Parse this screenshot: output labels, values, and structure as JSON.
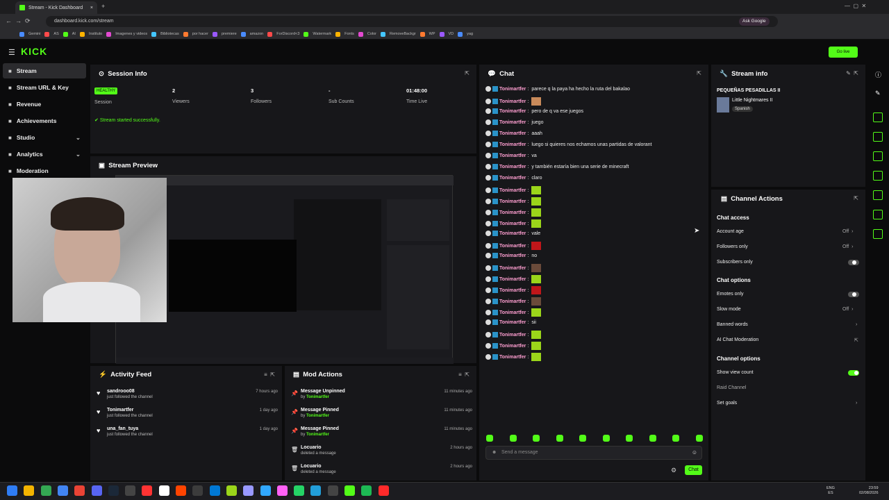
{
  "browser": {
    "tab_title": "Stream - Kick Dashboard",
    "url": "dashboard.kick.com/stream",
    "ask_google": "Ask Google",
    "bookmarks": [
      "Gemini",
      "AS",
      "AI",
      "Instituto",
      "Imagenes y videos",
      "Bibliotecas",
      "por hacer",
      "premiere",
      "amazon",
      "ForDiscord<3",
      "Watermark",
      "Fonts",
      "Color",
      "RemoveBackgr",
      "WP",
      "VD",
      "yag"
    ]
  },
  "brand": {
    "logo": "KICK",
    "accent": "#53fc18"
  },
  "header": {
    "go_live": "Go live"
  },
  "sidebar": {
    "items": [
      {
        "label": "Stream",
        "icon": "stream-icon"
      },
      {
        "label": "Stream URL & Key",
        "icon": "key-icon"
      },
      {
        "label": "Revenue",
        "icon": "money-icon"
      },
      {
        "label": "Achievements",
        "icon": "trophy-icon"
      },
      {
        "label": "Studio",
        "icon": "studio-icon"
      },
      {
        "label": "Analytics",
        "icon": "chart-icon"
      },
      {
        "label": "Moderation",
        "icon": "wrench-icon"
      }
    ]
  },
  "session": {
    "title": "Session Info",
    "health": "HEALTHY",
    "health_label": "Session",
    "viewers": "2",
    "viewers_label": "Viewers",
    "followers": "3",
    "followers_label": "Followers",
    "subs": "-",
    "subs_label": "Sub Counts",
    "time": "01:48:00",
    "time_label": "Time Live",
    "notice": "Stream started successfully."
  },
  "preview": {
    "title": "Stream Preview"
  },
  "activity": {
    "title": "Activity Feed",
    "items": [
      {
        "user": "sandrooo08",
        "text": "just followed the channel",
        "time": "7 hours ago"
      },
      {
        "user": "Tonimartfer",
        "text": "just followed the channel",
        "time": "1 day ago"
      },
      {
        "user": "una_fan_tuya",
        "text": "just followed the channel",
        "time": "1 day ago"
      }
    ]
  },
  "mod": {
    "title": "Mod Actions",
    "items": [
      {
        "action": "Message Unpinned",
        "by": "by",
        "user": "Tonimartfer",
        "time": "11 minutes ago"
      },
      {
        "action": "Message Pinned",
        "by": "by",
        "user": "Tonimartfer",
        "time": "11 minutes ago"
      },
      {
        "action": "Message Pinned",
        "by": "by",
        "user": "Tonimartfer",
        "time": "11 minutes ago"
      },
      {
        "action": "Locuario",
        "by": "deleted a message",
        "user": "",
        "time": "2 hours ago"
      },
      {
        "action": "Locuario",
        "by": "deleted a message",
        "user": "",
        "time": "2 hours ago"
      }
    ]
  },
  "chat": {
    "title": "Chat",
    "user": "Tonimartfer",
    "messages": [
      {
        "text": "parece q la paya ha hecho la ruta del bakalao",
        "emote": ""
      },
      {
        "text": "",
        "emote": "#c98a5a"
      },
      {
        "text": "pero de q va ese juegos",
        "emote": ""
      },
      {
        "text": "juego",
        "emote": ""
      },
      {
        "text": "aaah",
        "emote": ""
      },
      {
        "text": "luego si quieres nos echamos unas partidas de valorant",
        "emote": ""
      },
      {
        "text": "va",
        "emote": ""
      },
      {
        "text": "y también estaría bien una serie de minecraft",
        "emote": ""
      },
      {
        "text": "claro",
        "emote": ""
      },
      {
        "text": "",
        "emote": "#9bd51a"
      },
      {
        "text": "",
        "emote": "#9bd51a"
      },
      {
        "text": "",
        "emote": "#9bd51a"
      },
      {
        "text": "",
        "emote": "#9bd51a"
      },
      {
        "text": "vale",
        "emote": ""
      },
      {
        "text": "",
        "emote": "#c0161a"
      },
      {
        "text": "no",
        "emote": ""
      },
      {
        "text": "",
        "emote": "#6a4a3a"
      },
      {
        "text": "",
        "emote": "#9bd51a"
      },
      {
        "text": "",
        "emote": "#c0161a"
      },
      {
        "text": "",
        "emote": "#6a4a3a"
      },
      {
        "text": "",
        "emote": "#9bd51a"
      },
      {
        "text": "sii",
        "emote": ""
      },
      {
        "text": "",
        "emote": "#9bd51a"
      },
      {
        "text": "",
        "emote": "#9bd51a"
      },
      {
        "text": "",
        "emote": "#9bd51a"
      }
    ],
    "placeholder": "Send a message",
    "send": "Chat"
  },
  "stream_info": {
    "title": "Stream info",
    "stream_title": "PEQUEÑAS PESADILLAS II",
    "category": "Little Nightmares II",
    "language": "Spanish"
  },
  "channel_actions": {
    "title": "Channel Actions",
    "chat_access": "Chat access",
    "account_age": "Account age",
    "account_age_val": "Off",
    "followers_only": "Followers only",
    "followers_only_val": "Off",
    "subscribers_only": "Subscribers only",
    "chat_options": "Chat options",
    "emotes_only": "Emotes only",
    "slow_mode": "Slow mode",
    "slow_mode_val": "Off",
    "banned_words": "Banned words",
    "ai_mod": "AI Chat Moderation",
    "channel_options": "Channel options",
    "show_view_count": "Show view count",
    "raid": "Raid Channel",
    "goals": "Set goals"
  },
  "taskbar": {
    "lang": "ENG",
    "region": "ES",
    "time": "23:59",
    "date": "02/08/2026"
  }
}
